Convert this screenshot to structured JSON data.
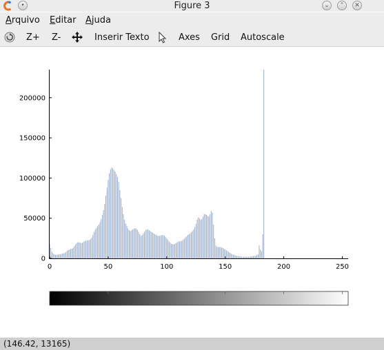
{
  "window": {
    "title": "Figure 3"
  },
  "menubar": {
    "items": [
      {
        "label": "Arquivo",
        "underline": "A",
        "rest": "rquivo"
      },
      {
        "label": "Editar",
        "underline": "E",
        "rest": "ditar"
      },
      {
        "label": "Ajuda",
        "underline": "A",
        "rest": "juda"
      }
    ]
  },
  "toolbar": {
    "reset_icon": "rotate-icon",
    "zoom_in_label": "Z+",
    "zoom_out_label": "Z-",
    "pan_icon": "move-arrows-icon",
    "insert_text_label": "Inserir Texto",
    "pointer_icon": "mouse-pointer-icon",
    "axes_label": "Axes",
    "grid_label": "Grid",
    "autoscale_label": "Autoscale"
  },
  "status": {
    "coordinates": "(146.42, 13165)"
  },
  "colors": {
    "bars": "#8fa4c4",
    "axis": "#000000",
    "chrome": "#ececec",
    "statusbar": "#cfcfcf"
  },
  "chart_data": {
    "type": "bar",
    "title": "",
    "xlabel": "",
    "ylabel": "",
    "xlim": [
      0,
      255
    ],
    "ylim": [
      0,
      235000
    ],
    "xticks": [
      0,
      50,
      100,
      150,
      200,
      250
    ],
    "yticks": [
      0,
      50000,
      100000,
      150000,
      200000
    ],
    "grid": false,
    "x_start": 0,
    "values": [
      18000,
      13000,
      8000,
      6000,
      5000,
      4500,
      4500,
      4500,
      5000,
      5000,
      5500,
      6000,
      6500,
      7000,
      8000,
      9500,
      10500,
      11000,
      11500,
      12000,
      13000,
      15000,
      17000,
      19000,
      20000,
      20000,
      19500,
      19000,
      19500,
      20500,
      21500,
      22000,
      22000,
      22500,
      23000,
      24000,
      26000,
      29000,
      33000,
      36000,
      38000,
      40000,
      42000,
      45000,
      49000,
      54000,
      60000,
      68000,
      78000,
      88000,
      98000,
      106000,
      111000,
      113000,
      112000,
      110000,
      108000,
      105000,
      101000,
      95000,
      85000,
      75000,
      64000,
      55000,
      48000,
      43000,
      40000,
      37000,
      35000,
      34000,
      35000,
      36000,
      37000,
      37500,
      37000,
      35500,
      33000,
      30000,
      28000,
      29000,
      31000,
      33000,
      35000,
      36000,
      36000,
      35000,
      34000,
      33000,
      32000,
      31000,
      30000,
      29000,
      28500,
      28000,
      28000,
      28500,
      29000,
      29000,
      28000,
      27000,
      25000,
      23000,
      21000,
      19500,
      18000,
      17500,
      17500,
      18000,
      19000,
      20000,
      21000,
      21000,
      21500,
      22000,
      23000,
      24500,
      26000,
      27500,
      29000,
      30000,
      31000,
      32500,
      34000,
      36000,
      39000,
      43000,
      48000,
      51000,
      50000,
      48000,
      49000,
      52000,
      55000,
      55000,
      54000,
      53000,
      52000,
      55000,
      59000,
      57000,
      42000,
      25000,
      16000,
      14500,
      14000,
      14000,
      14000,
      13500,
      13000,
      12000,
      11000,
      10000,
      9000,
      8000,
      7000,
      6000,
      5000,
      4500,
      4000,
      3500,
      3000,
      3000,
      2500,
      2500,
      2000,
      2000,
      2000,
      2000,
      2000,
      2000,
      2000,
      2000,
      2500,
      2500,
      3000,
      3000,
      3500,
      4000,
      5000,
      16000,
      11000,
      9000,
      30000,
      235000
    ]
  }
}
